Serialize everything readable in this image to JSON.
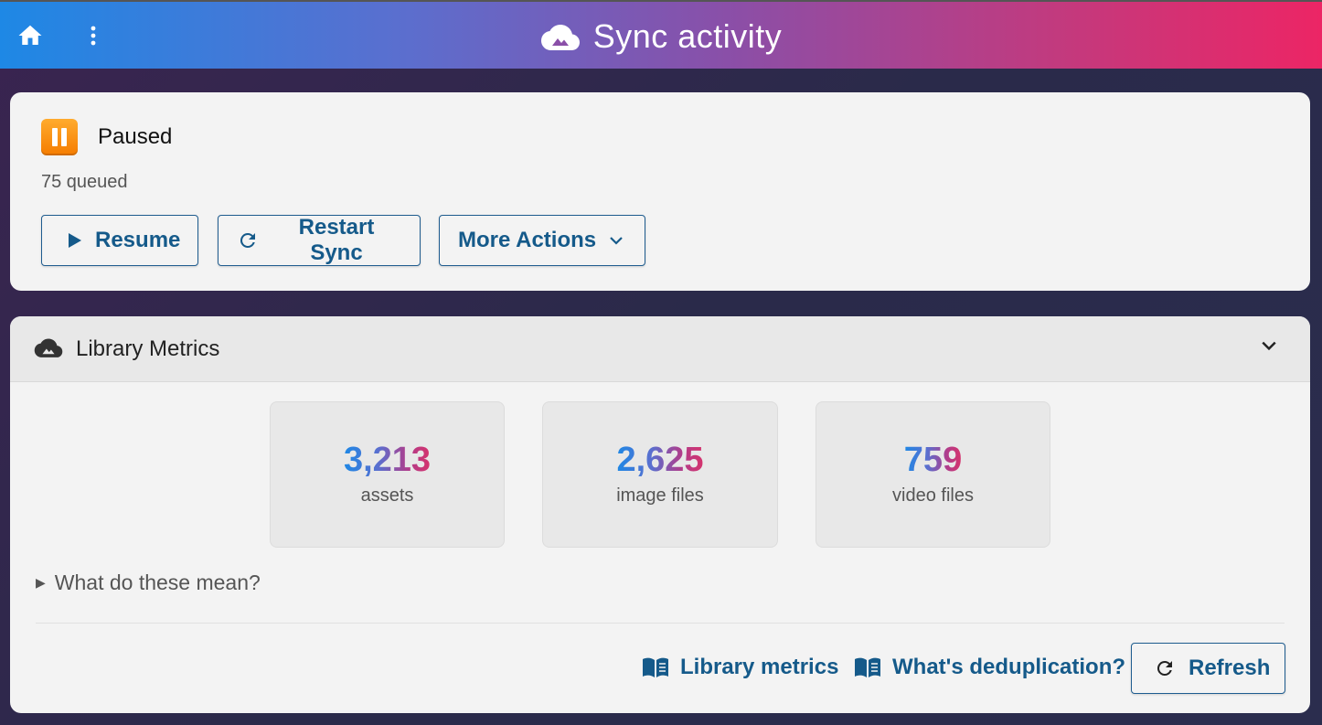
{
  "topbar": {
    "title": "Sync activity",
    "home_icon": "home-icon",
    "menu_icon": "kebab-menu-icon",
    "title_icon": "cloud-icon"
  },
  "status": {
    "icon": "pause-icon",
    "state": "Paused",
    "queued": "75 queued",
    "buttons": {
      "resume": "Resume",
      "restart": "Restart Sync",
      "more": "More Actions"
    }
  },
  "metrics": {
    "title": "Library Metrics",
    "tiles": [
      {
        "value": "3,213",
        "label": "assets"
      },
      {
        "value": "2,625",
        "label": "image files"
      },
      {
        "value": "759",
        "label": "video files"
      }
    ],
    "disclosure": "What do these mean?",
    "links": {
      "library_metrics": "Library metrics",
      "dedup": "What's deduplication?"
    },
    "refresh": "Refresh"
  },
  "colors": {
    "accent": "#155a8a",
    "pause_orange": "#f57c00",
    "gradient_start": "#1e88e5",
    "gradient_end": "#ec2565"
  }
}
